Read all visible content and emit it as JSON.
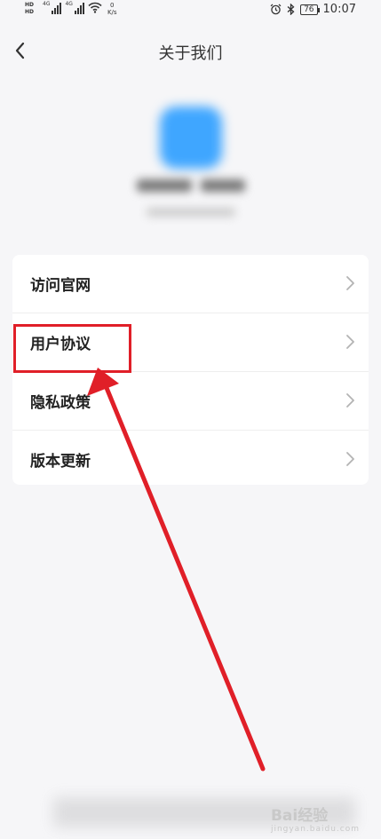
{
  "status_bar": {
    "hd_top": "HD",
    "hd_bottom": "HD",
    "net1": "4G",
    "net2": "4G",
    "speed_value": "0",
    "speed_unit": "K/s",
    "battery": "76",
    "time": "10:07"
  },
  "header": {
    "title": "关于我们",
    "back_icon": "chevron-left-icon"
  },
  "menu": {
    "items": [
      {
        "label": "访问官网"
      },
      {
        "label": "用户协议"
      },
      {
        "label": "隐私政策"
      },
      {
        "label": "版本更新"
      }
    ]
  },
  "watermark": {
    "brand": "Bai",
    "brand_suffix": "经验",
    "sub": "jingyan.baidu.com"
  },
  "colors": {
    "accent": "#3fa6ff",
    "annotation": "#e01f28",
    "background": "#f6f6f8"
  }
}
